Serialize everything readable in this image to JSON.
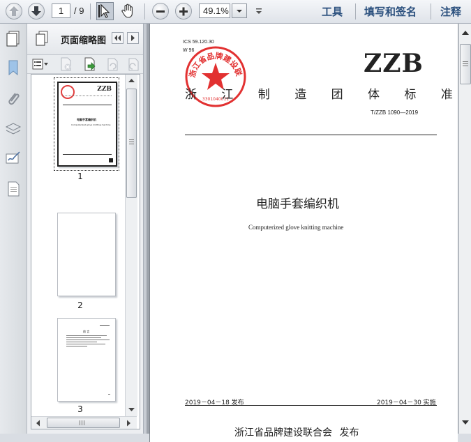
{
  "toolbar": {
    "page_current": "1",
    "page_total": "/ 9",
    "zoom": "49.1%",
    "tools_label": "工具",
    "fill_sign_label": "填写和签名",
    "comment_label": "注释"
  },
  "panel": {
    "title": "页面缩略图",
    "thumbnails": [
      {
        "label": "1"
      },
      {
        "label": "2"
      },
      {
        "label": "3"
      }
    ]
  },
  "document": {
    "ics": "ICS 59.120.30",
    "class_code": "W 96",
    "brand": "ZZB",
    "standard_title": "浙 江 制 造 团 体 标 准",
    "standard_no": "T/ZZB 1090—2019",
    "title_cn": "电脑手套编织机",
    "title_en": "Computerized glove knitting machine",
    "publish_date": "2019－04－18 发布",
    "effective_date": "2019－04－30 实施",
    "issuer": "浙江省品牌建设联合会  发布",
    "seal_text": "浙江省品牌建设联合会",
    "seal_number": "3301040011"
  },
  "thumb1": {
    "brand": "ZZB",
    "title": "电脑手套编织机",
    "subtitle": "Computerized glove knitting machine"
  },
  "thumb3": {
    "heading": "前  言"
  },
  "colors": {
    "toolbar_link": "#2a4f7d",
    "seal_red": "#e02020",
    "page_bg": "#ffffff",
    "view_bg": "#9da3ab"
  }
}
